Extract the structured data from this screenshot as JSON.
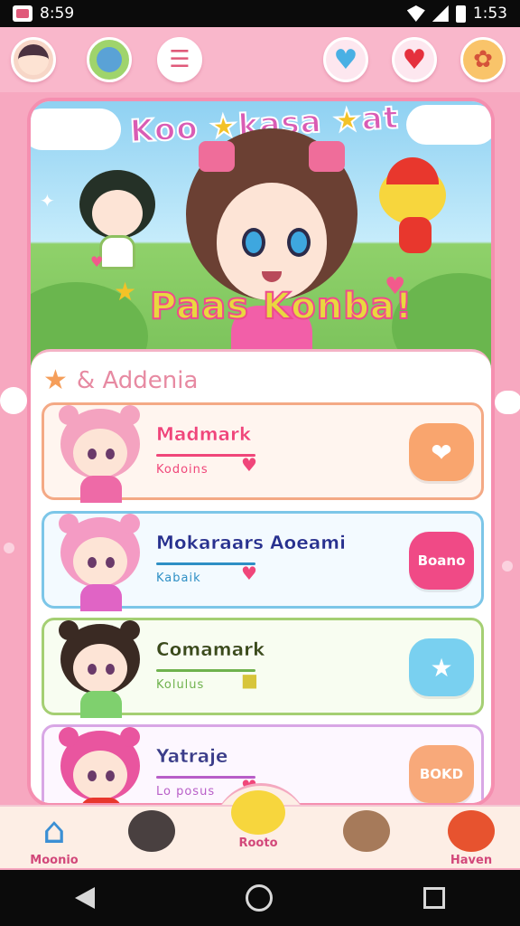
{
  "status_bar": {
    "time_left": "8:59",
    "time_right": "1:53",
    "icons": [
      "photo-icon",
      "wifi-icon",
      "signal-icon",
      "battery-icon"
    ]
  },
  "header": {
    "icons": [
      {
        "name": "user-avatar",
        "glyph": ""
      },
      {
        "name": "green-mascot-icon",
        "glyph": ""
      },
      {
        "name": "list-icon",
        "glyph": "☰"
      },
      {
        "name": "blue-heart-icon",
        "glyph": "♥"
      },
      {
        "name": "red-heart-icon",
        "glyph": "♥"
      },
      {
        "name": "character-icon",
        "glyph": "✿"
      }
    ]
  },
  "banner": {
    "title_left": "Koo",
    "title_star": "★",
    "title_mid": "kasa",
    "title_right": "at",
    "subtitle": "Paas Konba!"
  },
  "section": {
    "heading": "& Addenia"
  },
  "list_items": [
    {
      "title": "Madmark",
      "subtitle": "Kodoins",
      "badge": "♥",
      "button": "💙",
      "button_text": ""
    },
    {
      "title": "Mokaraars Aoeami",
      "subtitle": "Kabaik",
      "badge": "♥",
      "button": "",
      "button_text": "Boano"
    },
    {
      "title": "Comamark",
      "subtitle": "Kolulus",
      "badge": "■",
      "button": "★",
      "button_text": ""
    },
    {
      "title": "Yatraje",
      "subtitle": "Lo posus",
      "badge": "♥",
      "button": "",
      "button_text": "BOKD"
    }
  ],
  "colors": {
    "item_title": [
      "#f0467a",
      "#27318f",
      "#3b4b1b",
      "#3c3d8a"
    ],
    "item_sub": [
      "#f0467a",
      "#2e8fc5",
      "#6fb24d",
      "#b85ec8"
    ],
    "item_hair": [
      "#f4a3c0",
      "#f49bc4",
      "#3a2a23",
      "#e9559f"
    ],
    "item_body": [
      "#ee6aa7",
      "#e064c5",
      "#7fd06e",
      "#e8372d"
    ]
  },
  "bottom_nav": [
    {
      "label": "Moonio",
      "icon": "house-icon",
      "glyph": "⌂"
    },
    {
      "label": "",
      "icon": "bear-icon",
      "glyph": ""
    },
    {
      "label": "Rooto",
      "icon": "yellow-bear-icon",
      "glyph": ""
    },
    {
      "label": "",
      "icon": "dog-icon",
      "glyph": ""
    },
    {
      "label": "Haven",
      "icon": "fruit-icon",
      "glyph": ""
    }
  ]
}
